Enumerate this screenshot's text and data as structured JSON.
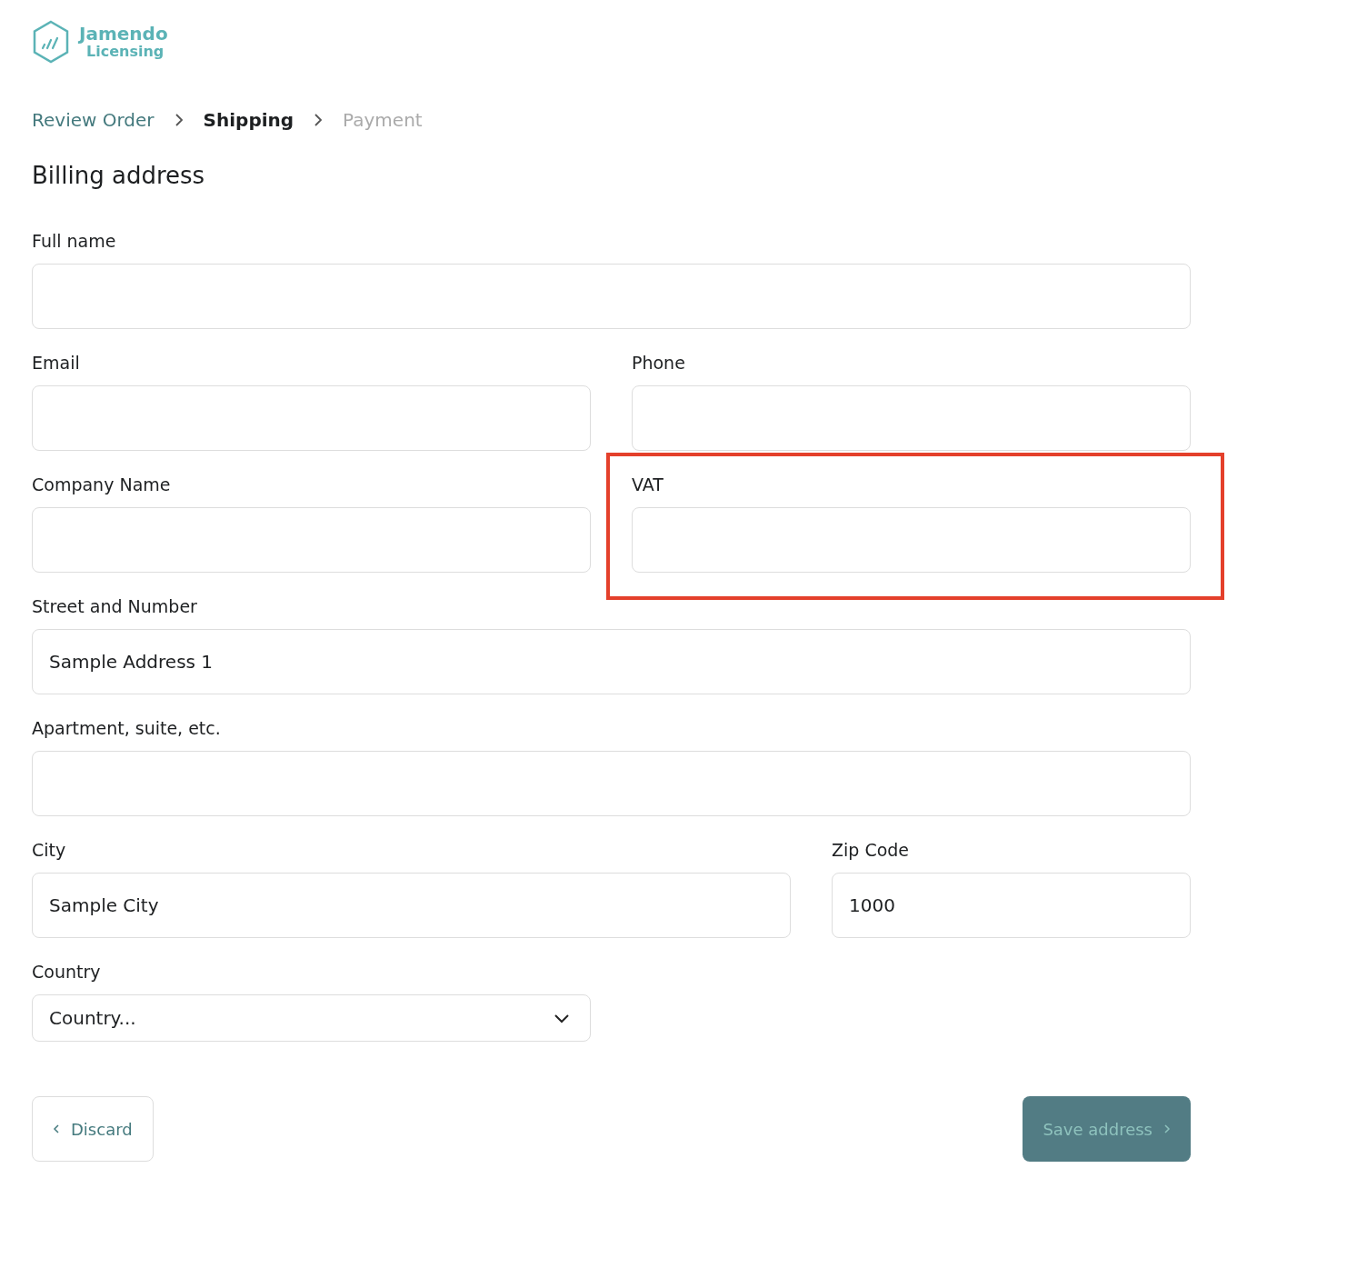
{
  "logo": {
    "name": "Jamendo",
    "subtitle": "Licensing"
  },
  "breadcrumb": [
    {
      "label": "Review Order",
      "selected": false,
      "completed": true
    },
    {
      "label": "Shipping",
      "selected": true,
      "completed": false
    },
    {
      "label": "Payment",
      "selected": false,
      "completed": false
    }
  ],
  "title": "Billing address",
  "rows": [
    {
      "fields": [
        {
          "kind": "text",
          "label": "Full name",
          "highlighted": false
        }
      ]
    },
    {
      "fields": [
        {
          "kind": "text",
          "label": "Email",
          "highlighted": false
        },
        {
          "kind": "text",
          "label": "Phone",
          "highlighted": false
        }
      ]
    },
    {
      "fields": [
        {
          "kind": "text",
          "label": "Company Name",
          "highlighted": false
        },
        {
          "kind": "text",
          "label": "VAT",
          "highlighted": true
        }
      ]
    },
    {
      "fields": [
        {
          "kind": "text",
          "label": "Street and Number",
          "value": "Sample Address 1",
          "highlighted": false
        }
      ]
    },
    {
      "fields": [
        {
          "kind": "text",
          "label": "Apartment, suite, etc.",
          "highlighted": false
        }
      ]
    },
    {
      "fields": [
        {
          "kind": "text",
          "label": "City",
          "value": "Sample City",
          "highlighted": false
        },
        {
          "kind": "text",
          "label": "Zip Code",
          "value": "1000",
          "highlighted": false
        }
      ]
    },
    {
      "fields": [
        {
          "kind": "select",
          "label": "Country",
          "value": "Country...",
          "highlighted": false
        }
      ]
    }
  ],
  "buttons": [
    {
      "kind": "back",
      "label": "Discard",
      "disabled": false
    },
    {
      "kind": "next",
      "label": "Save address",
      "disabled": true
    }
  ]
}
